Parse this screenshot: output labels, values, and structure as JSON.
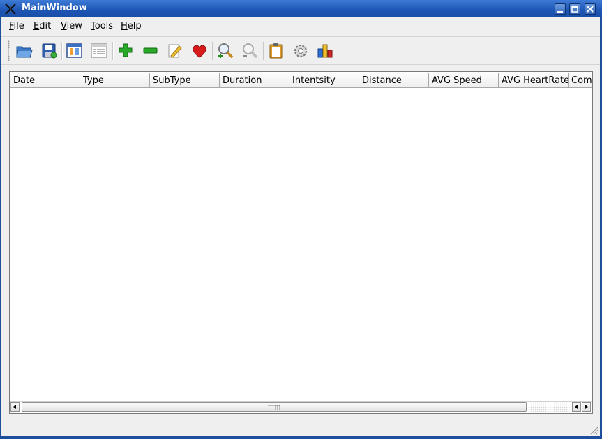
{
  "window": {
    "title": "MainWindow"
  },
  "menubar": {
    "items": [
      {
        "label": "File"
      },
      {
        "label": "Edit"
      },
      {
        "label": "View"
      },
      {
        "label": "Tools"
      },
      {
        "label": "Help"
      }
    ]
  },
  "toolbar": {
    "buttons": [
      {
        "icon": "open-folder-icon"
      },
      {
        "icon": "save-icon"
      },
      {
        "icon": "calendar-view-icon"
      },
      {
        "icon": "list-view-icon"
      },
      {
        "icon": "add-icon"
      },
      {
        "icon": "remove-icon"
      },
      {
        "icon": "edit-icon"
      },
      {
        "icon": "heart-icon"
      },
      {
        "icon": "zoom-in-icon"
      },
      {
        "icon": "zoom-out-icon"
      },
      {
        "icon": "clipboard-icon"
      },
      {
        "icon": "settings-gear-icon"
      },
      {
        "icon": "statistics-icon"
      }
    ]
  },
  "table": {
    "columns": [
      "Date",
      "Type",
      "SubType",
      "Duration",
      "Intentsity",
      "Distance",
      "AVG Speed",
      "AVG HeartRate",
      "Comm"
    ],
    "rows": []
  },
  "colors": {
    "titlebar": "#1d55b4",
    "window_bg": "#efefef"
  }
}
